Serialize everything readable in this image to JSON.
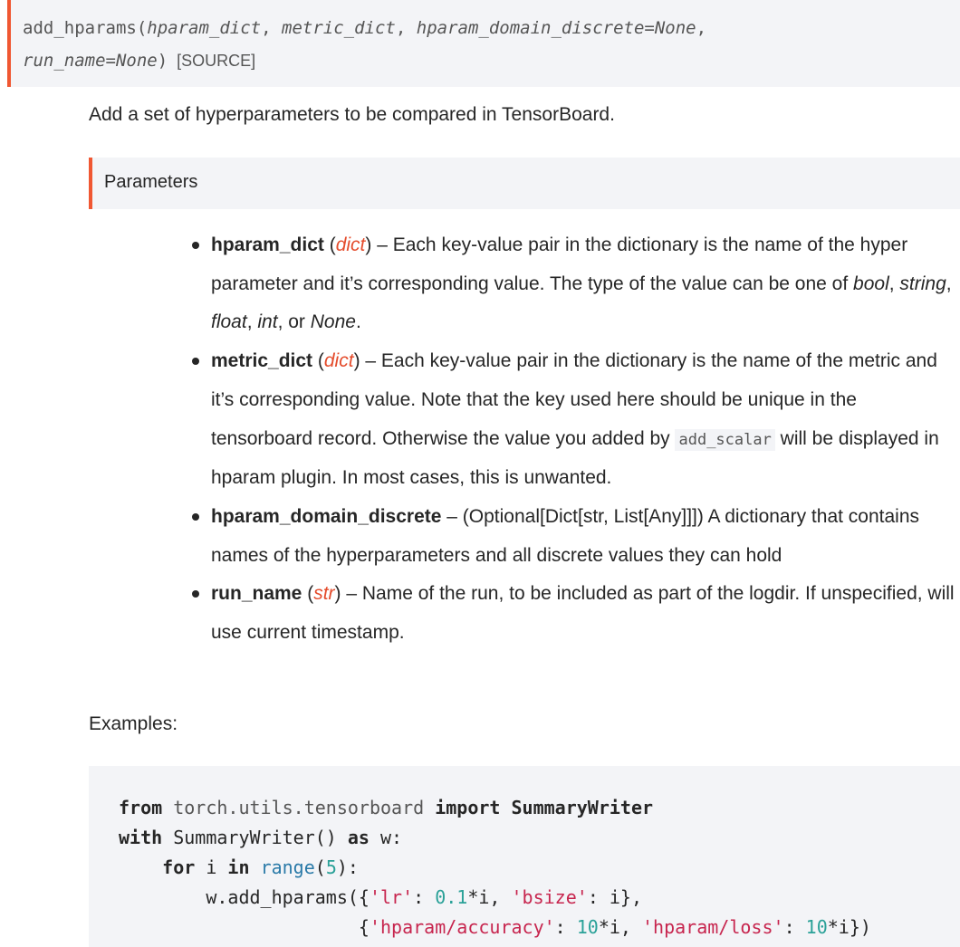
{
  "signature": {
    "func_name": "add_hparams",
    "open_paren": "(",
    "arg1": "hparam_dict",
    "sep1": ", ",
    "arg2": "metric_dict",
    "sep2": ", ",
    "arg3": "hparam_domain_discrete=None",
    "sep3": ",",
    "arg4": "run_name=None",
    "close_paren": ")",
    "source_label": "[SOURCE]"
  },
  "summary": "Add a set of hyperparameters to be compared in TensorBoard.",
  "parameters_heading": "Parameters",
  "parameters": [
    {
      "name": "hparam_dict",
      "type": "dict",
      "desc_a": " – Each key-value pair in the dictionary is the name of the hyper parameter and it’s corresponding value. The type of the value can be one of ",
      "t1": "bool",
      "c1": ", ",
      "t2": "string",
      "c2": ", ",
      "t3": "float",
      "c3": ", ",
      "t4": "int",
      "c4": ", or ",
      "t5": "None",
      "c5": "."
    },
    {
      "name": "metric_dict",
      "type": "dict",
      "desc_a": " – Each key-value pair in the dictionary is the name of the metric and it’s corresponding value. Note that the key used here should be unique in the tensorboard record. Otherwise the value you added by ",
      "code": "add_scalar",
      "desc_b": " will be displayed in hparam plugin. In most cases, this is unwanted."
    },
    {
      "name": "hparam_domain_discrete",
      "desc_a": " – (Optional[Dict[str, List[Any]]]) A dictionary that contains names of the hyperparameters and all discrete values they can hold"
    },
    {
      "name": "run_name",
      "type": "str",
      "desc_a": " – Name of the run, to be included as part of the logdir. If unspecified, will use current timestamp."
    }
  ],
  "examples_label": "Examples:",
  "code": {
    "l1_from": "from",
    "l1_mod": " torch.utils.tensorboard ",
    "l1_import": "import",
    "l1_rest": " SummaryWriter",
    "l2_with": "with",
    "l2_rest": " SummaryWriter() ",
    "l2_as": "as",
    "l2_end": " w:",
    "l3_indent": "    ",
    "l3_for": "for",
    "l3_i": " i ",
    "l3_in": "in",
    "l3_sp": " ",
    "l3_range": "range",
    "l3_p": "(",
    "l3_num": "5",
    "l3_end": "):",
    "l4_indent": "        w.add_hparams({",
    "l4_s1": "'lr'",
    "l4_c1": ": ",
    "l4_n1": "0.1",
    "l4_m1": "*i, ",
    "l4_s2": "'bsize'",
    "l4_c2": ": i},",
    "l5_indent": "                      {",
    "l5_s1": "'hparam/accuracy'",
    "l5_c1": ": ",
    "l5_n1": "10",
    "l5_m1": "*i, ",
    "l5_s2": "'hparam/loss'",
    "l5_c2": ": ",
    "l5_n2": "10",
    "l5_m2": "*i})"
  }
}
